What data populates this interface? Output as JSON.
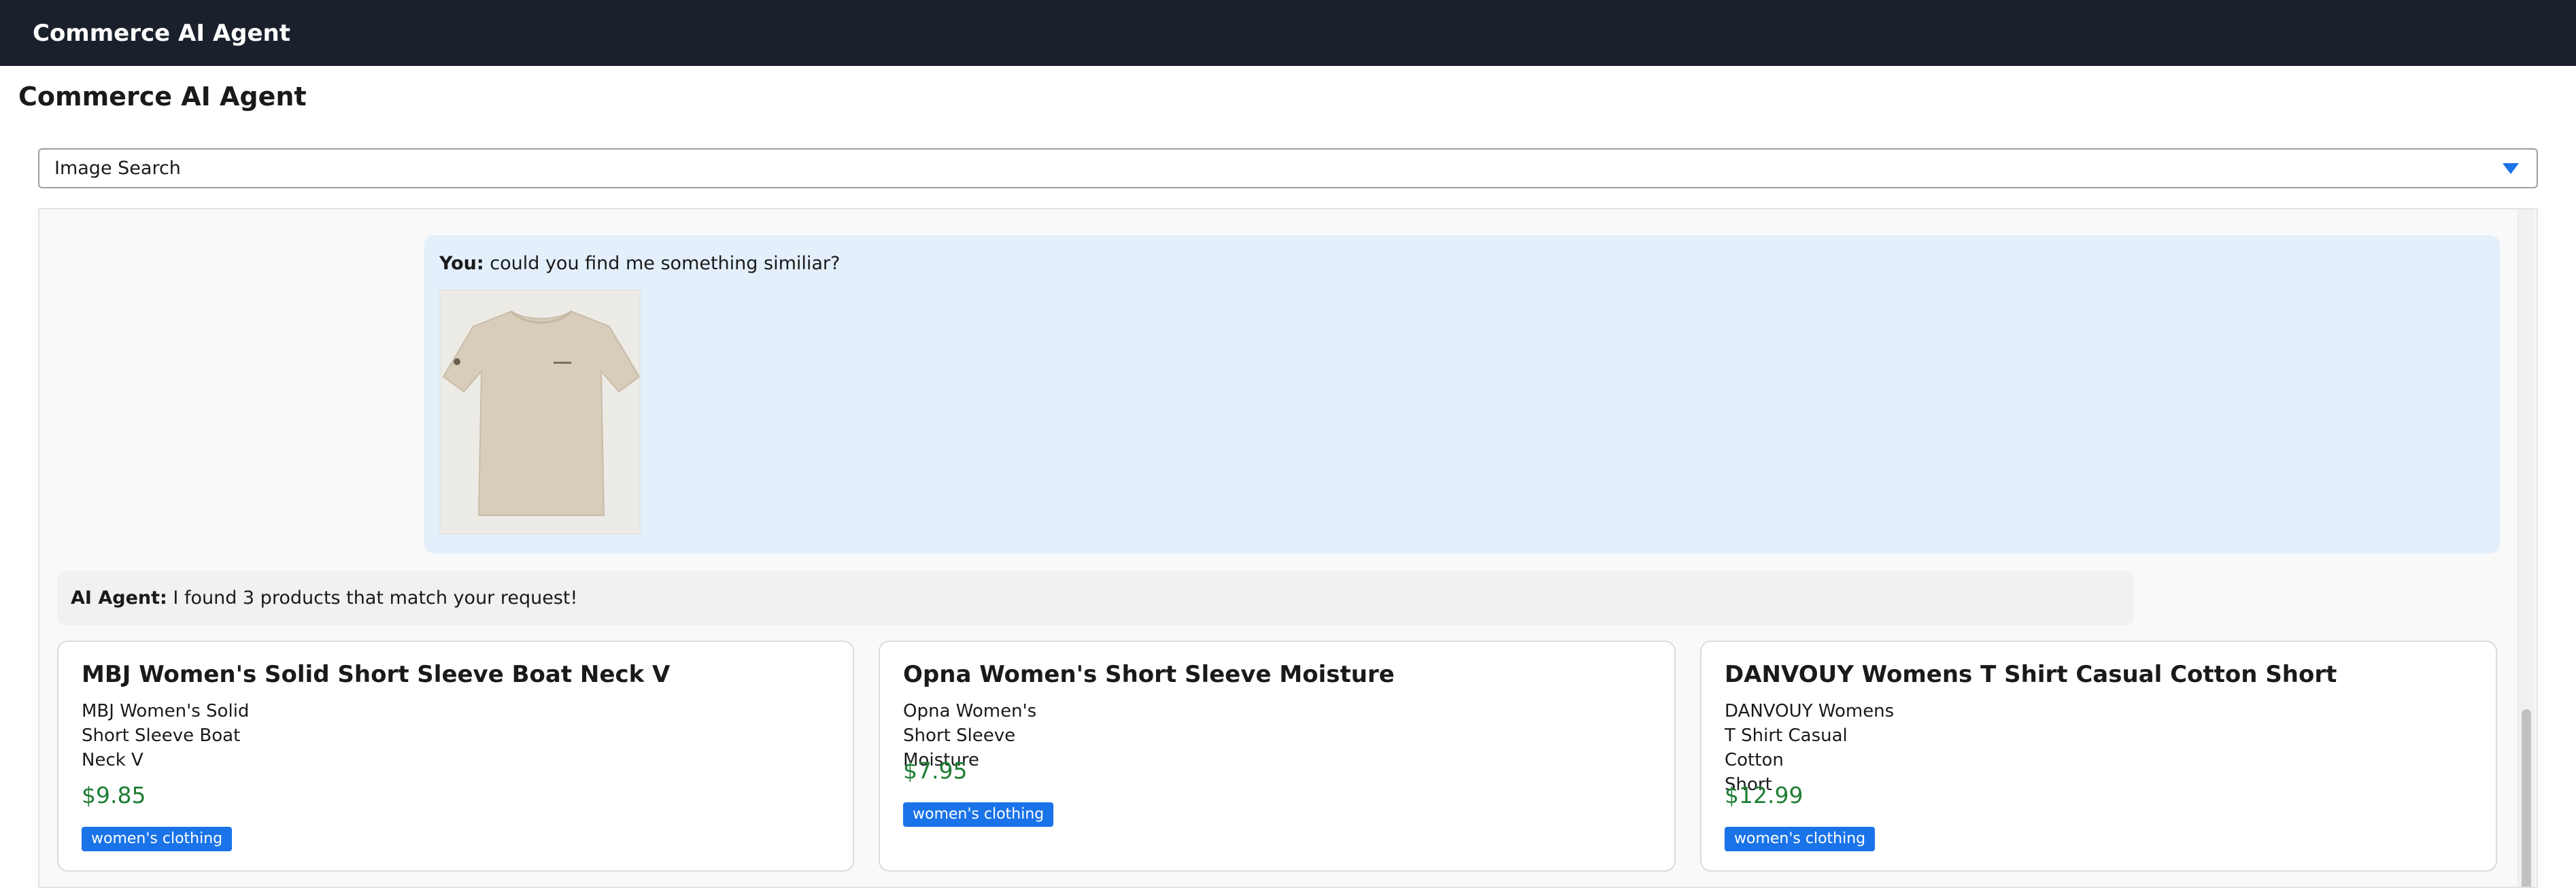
{
  "topbar": {
    "title": "Commerce AI Agent"
  },
  "page": {
    "title": "Commerce AI Agent"
  },
  "mode_select": {
    "value": "Image Search",
    "caret_icon": "triangle-down-icon"
  },
  "chat": {
    "user": {
      "label": "You:",
      "text": "could you find me something similiar?"
    },
    "agent": {
      "label": "AI Agent:",
      "text": "I found 3 products that match your request!"
    },
    "products": [
      {
        "title": "MBJ Women's Solid Short Sleeve Boat Neck V",
        "alt_lines": [
          "MBJ Women's Solid",
          "Short Sleeve Boat",
          "Neck V"
        ],
        "price": "$9.85",
        "category": "women's clothing"
      },
      {
        "title": "Opna Women's Short Sleeve Moisture",
        "alt_lines": [
          "Opna Women's",
          "Short Sleeve Moisture"
        ],
        "price": "$7.95",
        "category": "women's clothing"
      },
      {
        "title": "DANVOUY Womens T Shirt Casual Cotton Short",
        "alt_lines": [
          "DANVOUY Womens",
          "T Shirt Casual Cotton",
          "Short"
        ],
        "price": "$12.99",
        "category": "women's clothing"
      }
    ]
  },
  "colors": {
    "topbar": "#1a202c",
    "user_bubble": "#e3effa",
    "price": "#1e7e34",
    "badge": "#1a73e8"
  }
}
